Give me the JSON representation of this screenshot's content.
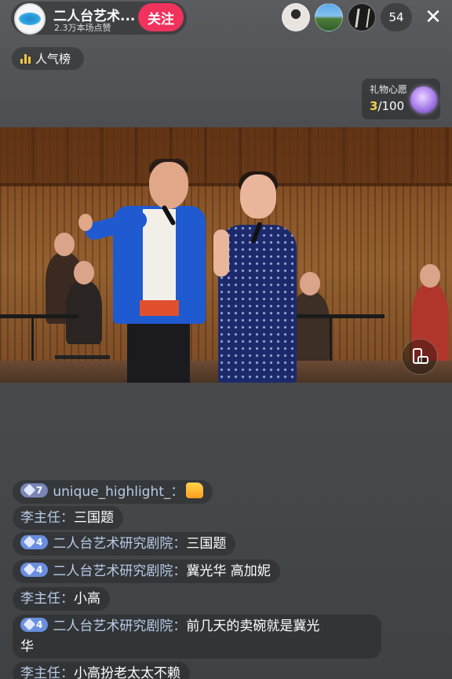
{
  "header": {
    "host_name": "二人台艺术...",
    "likes_text": "2.3万本场点赞",
    "follow_label": "关注",
    "viewer_count": "54",
    "close_glyph": "✕"
  },
  "rank": {
    "label": "人气榜"
  },
  "wish": {
    "title": "礼物心愿",
    "current": "3",
    "total": "/100"
  },
  "chat": [
    {
      "badge_level": "7",
      "badge_color": "#7a86b8",
      "user": "unique_highlight_",
      "sep": "：",
      "text": "",
      "has_emoji": true,
      "emoji": "thumbs-up-emoji"
    },
    {
      "badge_level": "",
      "user": "李主任",
      "sep": "：",
      "text": "三国题"
    },
    {
      "badge_level": "4",
      "badge_color": "#6a8fe0",
      "user": "二人台艺术研究剧院",
      "sep": "：",
      "text": "三国题"
    },
    {
      "badge_level": "4",
      "badge_color": "#6a8fe0",
      "user": "二人台艺术研究剧院",
      "sep": "：",
      "text": "冀光华 高加妮"
    },
    {
      "badge_level": "",
      "user": "李主任",
      "sep": "：",
      "text": "小高"
    },
    {
      "badge_level": "4",
      "badge_color": "#6a8fe0",
      "user": "二人台艺术研究剧院",
      "sep": "：",
      "text": "前几天的卖碗就是冀光",
      "text2": "华"
    },
    {
      "badge_level": "",
      "user": "李主任",
      "sep": "：",
      "text": "小高扮老太太不赖"
    }
  ],
  "colors": {
    "follow": "#f0325d",
    "accent_gold": "#f7d04a",
    "username": "#b9cbe6"
  }
}
